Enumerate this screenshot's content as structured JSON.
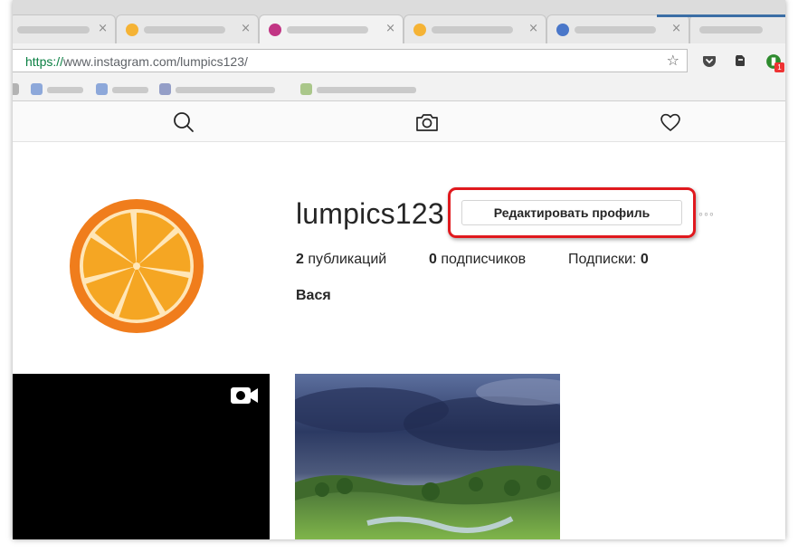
{
  "browser": {
    "url_scheme": "https://",
    "url_rest": "www.instagram.com/lumpics123/",
    "tab_close_glyph": "×",
    "bookmark_star_icon": "star-icon",
    "extension_badge": "1"
  },
  "profile": {
    "username": "lumpics123",
    "edit_button_label": "Редактировать профиль",
    "more_glyph": "◦◦◦",
    "posts_count": "2",
    "posts_label": "публикаций",
    "followers_count": "0",
    "followers_label": "подписчиков",
    "following_label": "Подписки:",
    "following_count": "0",
    "full_name": "Вася"
  },
  "colors": {
    "highlight_frame": "#e0191e",
    "url_scheme": "#0b8043",
    "avatar_orange": "#f07d1c"
  }
}
